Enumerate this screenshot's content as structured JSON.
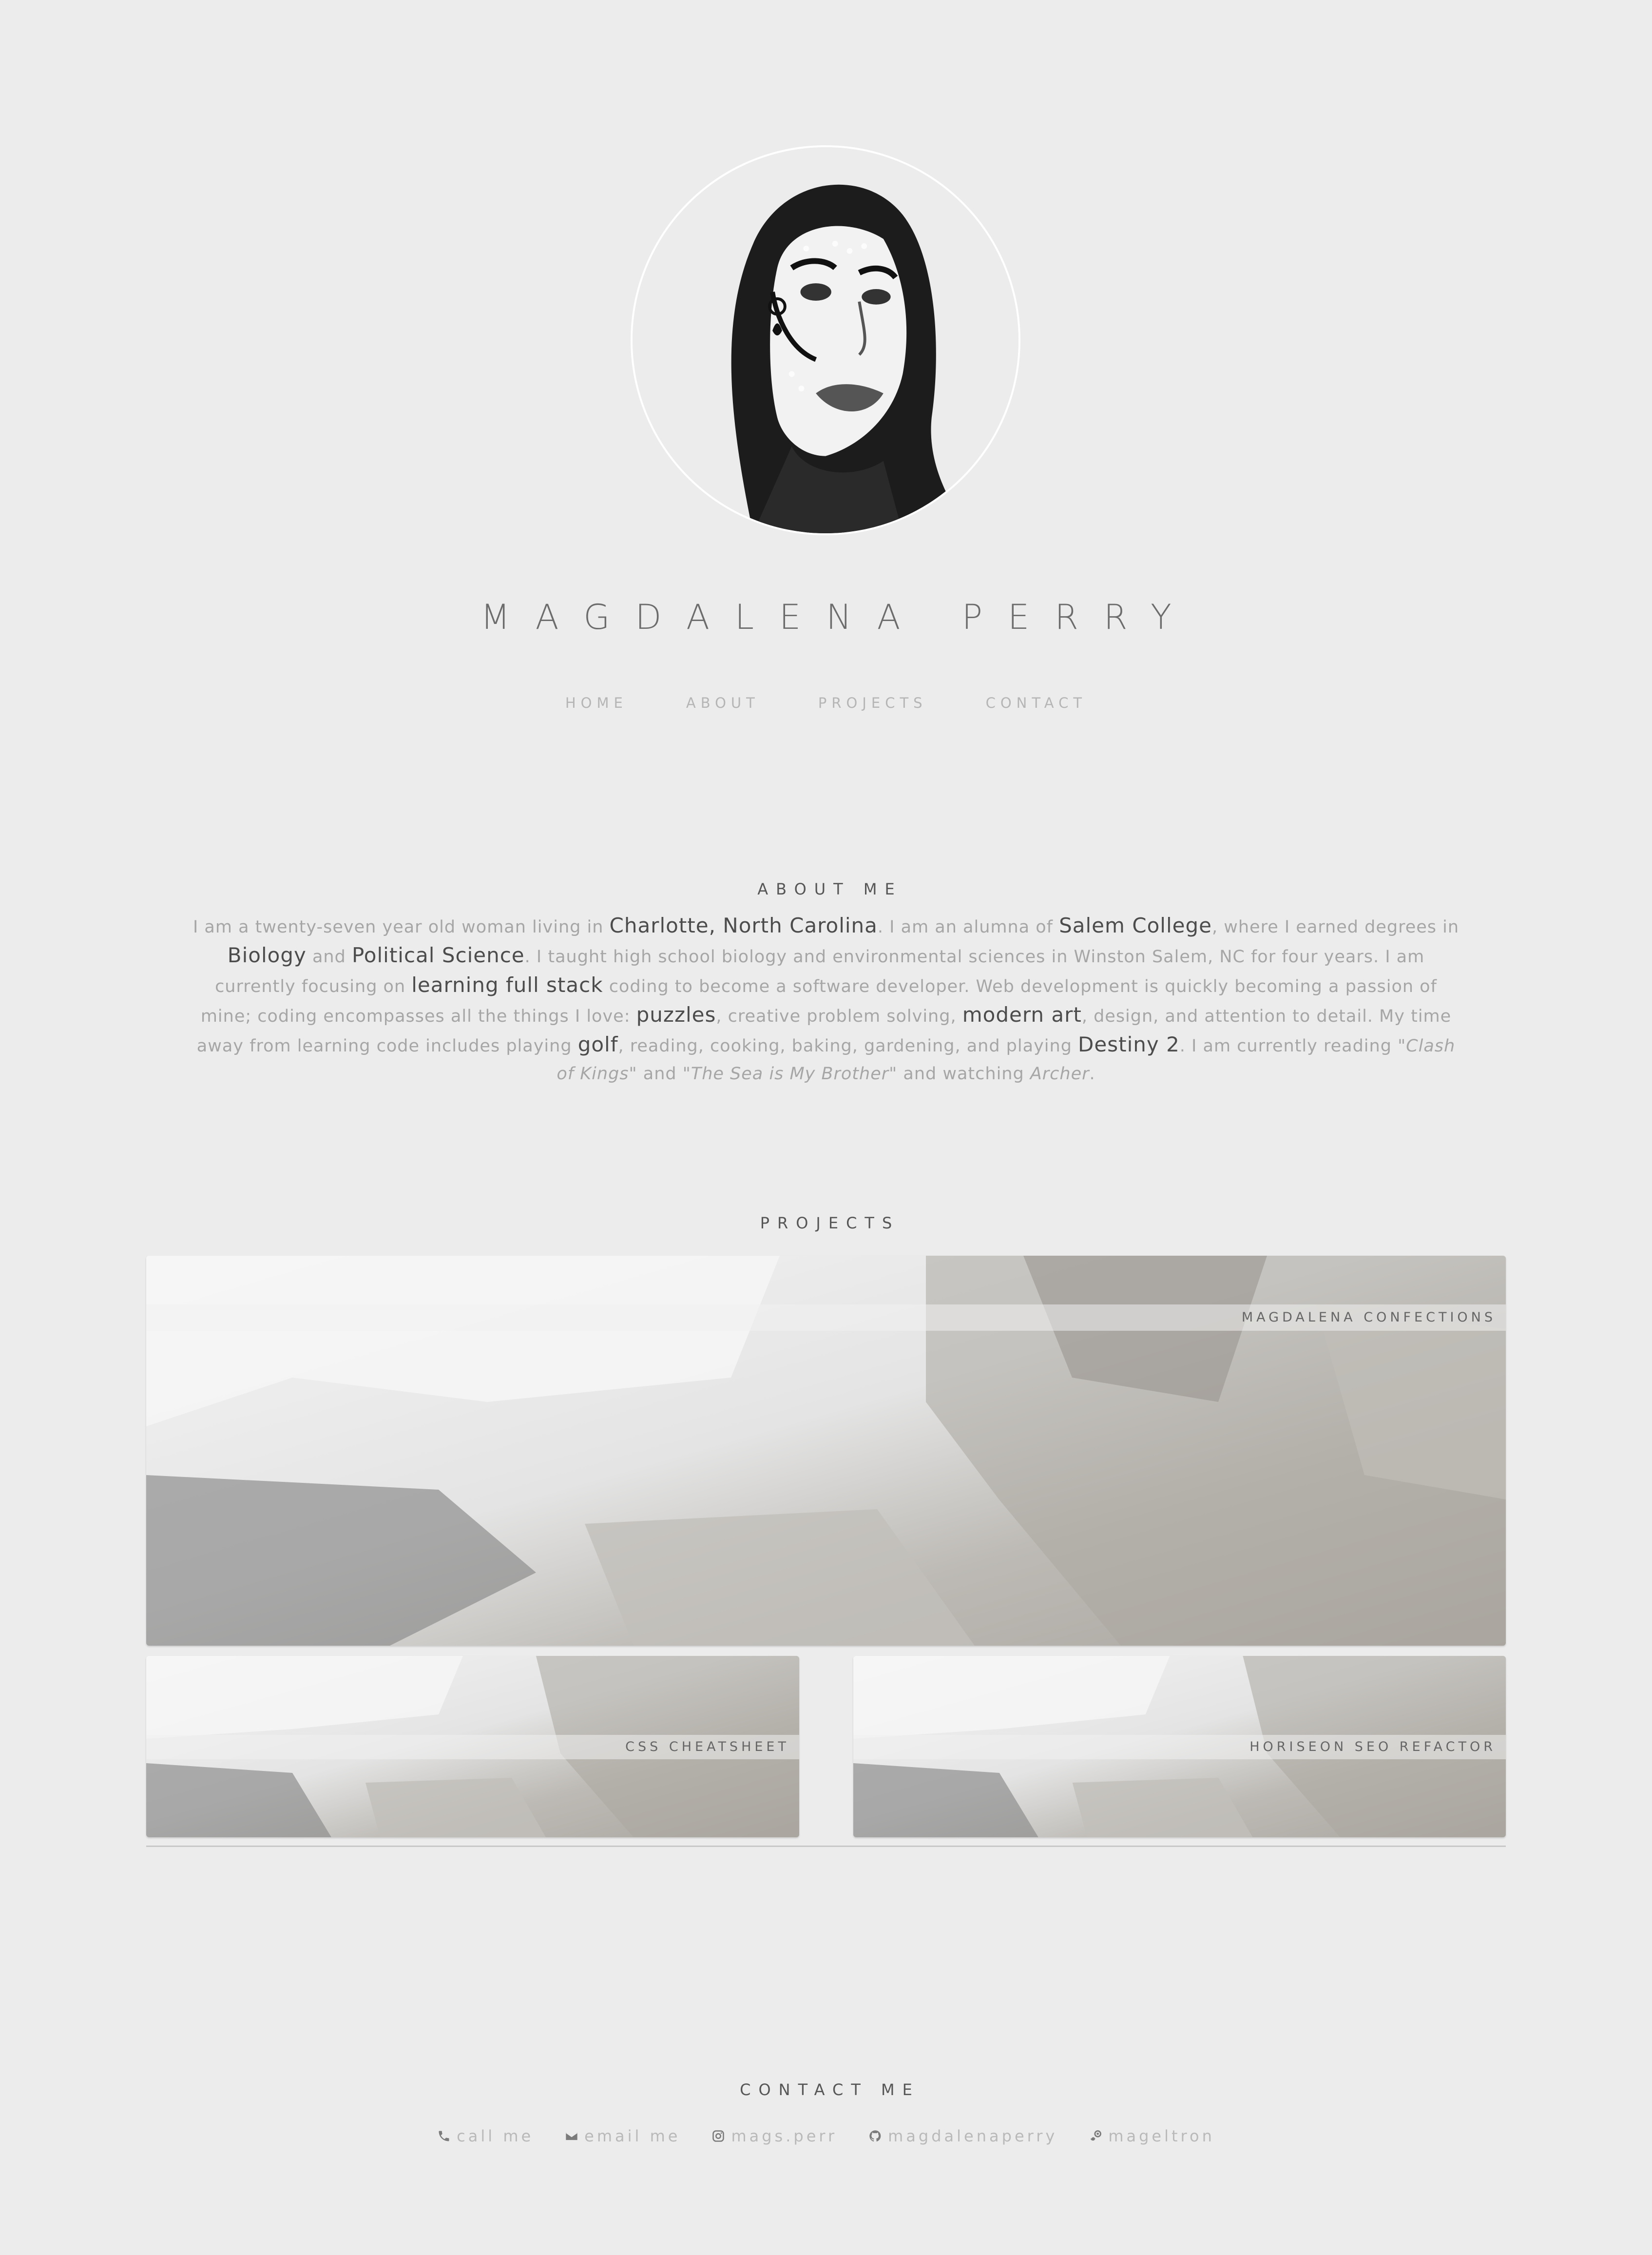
{
  "header": {
    "name": "MAGDALENA PERRY",
    "avatar_alt": "portrait-photo"
  },
  "nav": {
    "items": [
      "HOME",
      "ABOUT",
      "PROJECTS",
      "CONTACT"
    ]
  },
  "about": {
    "heading": "ABOUT ME",
    "t1": "I am a twenty-seven year old woman living in ",
    "h1": "Charlotte, North Carolina",
    "t2": ". I am an alumna of ",
    "h2": "Salem College",
    "t3": ", where I earned degrees in ",
    "h3": "Biology",
    "t4": " and ",
    "h4": "Political Science",
    "t5": ". I taught high school biology and environmental sciences in Winston Salem, NC for four years. I am currently focusing on ",
    "h5": "learning full stack",
    "t6": " coding to become a software developer. Web development is quickly becoming a passion of mine; coding encompasses all the things I love: ",
    "h6": "puzzles",
    "t7": ", creative problem solving, ",
    "h7": "modern art",
    "t8": ", design, and attention to detail. My time away from learning code includes playing ",
    "h8": "golf",
    "t9": ", reading, cooking, baking, gardening, and playing ",
    "h9": "Destiny 2",
    "t10": ". I am currently reading ",
    "i1": "\"Clash of Kings\"",
    "t11": " and ",
    "i2": "\"The Sea is My Brother\"",
    "t12": " and watching ",
    "i3": "Archer",
    "t13": "."
  },
  "projects": {
    "heading": "PROJECTS",
    "items": [
      {
        "title": "MAGDALENA CONFECTIONS"
      },
      {
        "title": "CSS CHEATSHEET"
      },
      {
        "title": "HORISEON SEO REFACTOR"
      }
    ]
  },
  "contact": {
    "heading": "CONTACT ME",
    "items": [
      {
        "label": "call me",
        "icon": "phone-icon"
      },
      {
        "label": "email me",
        "icon": "envelope-icon"
      },
      {
        "label": "mags.perr",
        "icon": "instagram-icon"
      },
      {
        "label": "magdalenaperry",
        "icon": "github-icon"
      },
      {
        "label": "mageltron",
        "icon": "steam-icon"
      }
    ]
  }
}
